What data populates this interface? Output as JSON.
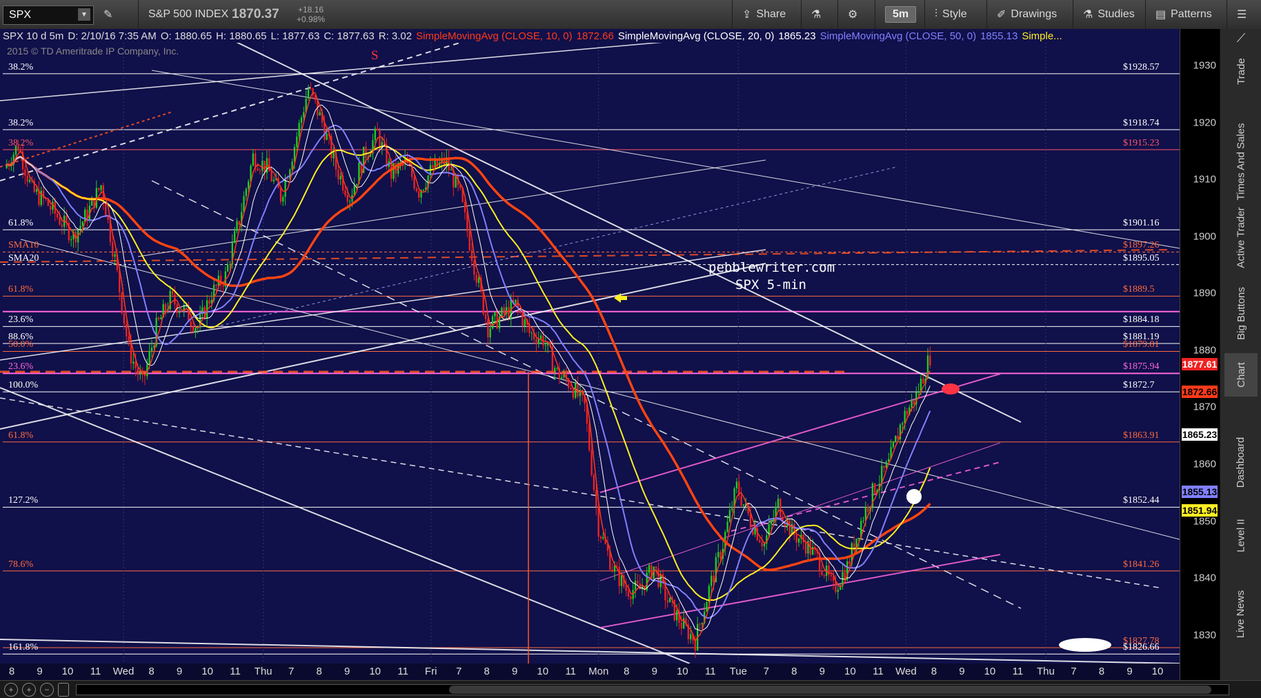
{
  "toolbar": {
    "symbol": "SPX",
    "index_name": "S&P 500 INDEX",
    "last_price": "1870.37",
    "change": "+18.16",
    "change_pct": "+0.98%",
    "share": "Share",
    "timeframe": "5m",
    "style": "Style",
    "drawings": "Drawings",
    "studies": "Studies",
    "patterns": "Patterns"
  },
  "studyline": {
    "desc": "SPX 10 d 5m",
    "date": "D: 2/10/16 7:35 AM",
    "open": "O: 1880.65",
    "high": "H: 1880.65",
    "low": "L: 1877.63",
    "close": "C: 1877.63",
    "range": "R: 3.02",
    "sma10_label": "SimpleMovingAvg (CLOSE, 10, 0)",
    "sma10_val": "1872.66",
    "sma20_label": "SimpleMovingAvg (CLOSE, 20, 0)",
    "sma20_val": "1865.23",
    "sma50_label": "SimpleMovingAvg (CLOSE, 50, 0)",
    "sma50_val": "1855.13",
    "more": "Simple..."
  },
  "copyright": "2015 © TD Ameritrade IP Company, Inc.",
  "watermark": {
    "line1": "pebblewriter.com",
    "line2": "SPX 5-min"
  },
  "marker_s": "S",
  "colors": {
    "sma10": "#ff3a1a",
    "sma20": "#ffffff",
    "sma50": "#8080ff",
    "sma200": "#ffee22",
    "fib": "#ff6b3d",
    "pink": "#ff66dd",
    "up": "#22cc22",
    "down": "#ee2222"
  },
  "chart_data": {
    "type": "candlestick",
    "title": "SPX 5-min",
    "ylim": [
      1825,
      1934
    ],
    "x_labels": [
      "8",
      "9",
      "10",
      "11",
      "Wed",
      "8",
      "9",
      "10",
      "11",
      "Thu",
      "7",
      "8",
      "9",
      "10",
      "11",
      "Fri",
      "7",
      "8",
      "9",
      "10",
      "11",
      "Mon",
      "8",
      "9",
      "10",
      "11",
      "Tue",
      "7",
      "8",
      "9",
      "10",
      "11",
      "Wed",
      "8",
      "9",
      "10",
      "11",
      "Thu",
      "7",
      "8",
      "9",
      "10"
    ],
    "y_ticks": [
      1830,
      1840,
      1850,
      1860,
      1870,
      1880,
      1890,
      1900,
      1910,
      1920,
      1930
    ],
    "price_tags": [
      {
        "value": 1877.61,
        "label": "1877.61",
        "bg": "#ee2222",
        "fg": "#ffffff"
      },
      {
        "value": 1872.66,
        "label": "1872.66",
        "bg": "#ff3a1a",
        "fg": "#000000"
      },
      {
        "value": 1865.23,
        "label": "1865.23",
        "bg": "#ffffff",
        "fg": "#000000"
      },
      {
        "value": 1855.13,
        "label": "1855.13",
        "bg": "#8080ff",
        "fg": "#000000"
      },
      {
        "value": 1851.94,
        "label": "1851.94",
        "bg": "#ffee22",
        "fg": "#000000"
      }
    ],
    "levels": [
      {
        "value": 1928.57,
        "label": "$1928.57",
        "color": "#ffffff",
        "left": "38.2%",
        "lc": "#ffffff"
      },
      {
        "value": 1918.74,
        "label": "$1918.74",
        "color": "#ffffff",
        "left": "38.2%",
        "lc": "#ffffff"
      },
      {
        "value": 1915.23,
        "label": "$1915.23",
        "color": "#ff5566",
        "left": "38.2%",
        "lc": "#ff5566"
      },
      {
        "value": 1901.16,
        "label": "$1901.16",
        "color": "#ffffff",
        "left": "61.8%",
        "lc": "#ffffff"
      },
      {
        "value": 1897.26,
        "label": "$1897.26",
        "color": "#ff6b3d",
        "left": "SMA10",
        "lc": "#ff6b3d"
      },
      {
        "value": 1895.05,
        "label": "$1895.05",
        "color": "#ffffff",
        "left": "SMA20",
        "lc": "#ffffff"
      },
      {
        "value": 1889.5,
        "label": "$1889.5",
        "color": "#ff6b3d",
        "left": "61.8%",
        "lc": "#ff6b3d"
      },
      {
        "value": 1886.8,
        "label": "",
        "color": "#ff66dd",
        "left": "",
        "lc": "#ff66dd"
      },
      {
        "value": 1884.18,
        "label": "$1884.18",
        "color": "#ffffff",
        "left": "23.6%",
        "lc": "#ffffff"
      },
      {
        "value": 1881.19,
        "label": "$1881.19",
        "color": "#ffffff",
        "left": "88.6%",
        "lc": "#ffffff"
      },
      {
        "value": 1879.81,
        "label": "$1879.81",
        "color": "#ff6b3d",
        "left": "50.0%",
        "lc": "#ff6b3d"
      },
      {
        "value": 1875.94,
        "label": "$1875.94",
        "color": "#ff66dd",
        "left": "23.6%",
        "lc": "#ff66dd"
      },
      {
        "value": 1872.7,
        "label": "$1872.7",
        "color": "#ffffff",
        "left": "100.0%",
        "lc": "#ffffff"
      },
      {
        "value": 1863.91,
        "label": "$1863.91",
        "color": "#ff6b3d",
        "left": "61.8%",
        "lc": "#ff6b3d"
      },
      {
        "value": 1852.44,
        "label": "$1852.44",
        "color": "#ffffff",
        "left": "127.2%",
        "lc": "#ffffff"
      },
      {
        "value": 1841.26,
        "label": "$1841.26",
        "color": "#ff6b3d",
        "left": "78.6%",
        "lc": "#ff6b3d"
      },
      {
        "value": 1827.78,
        "label": "$1827.78",
        "color": "#ff6b3d",
        "left": "",
        "lc": "#ff6b3d"
      },
      {
        "value": 1826.66,
        "label": "$1826.66",
        "color": "#ffffff",
        "left": "161.8%",
        "lc": "#ffffff"
      }
    ],
    "price_path": [
      1912,
      1916,
      1908,
      1906,
      1903,
      1900,
      1904,
      1909,
      1896,
      1880,
      1874,
      1884,
      1889,
      1887,
      1884,
      1890,
      1893,
      1903,
      1914,
      1912,
      1907,
      1916,
      1926,
      1920,
      1912,
      1907,
      1914,
      1918,
      1911,
      1913,
      1908,
      1912,
      1913,
      1907,
      1895,
      1884,
      1886,
      1888,
      1883,
      1882,
      1876,
      1874,
      1870,
      1849,
      1842,
      1838,
      1838,
      1842,
      1836,
      1832,
      1829,
      1838,
      1846,
      1856,
      1850,
      1846,
      1853,
      1848,
      1846,
      1843,
      1838,
      1842,
      1850,
      1856,
      1860,
      1868,
      1872,
      1879
    ]
  },
  "sidebar": {
    "tabs": [
      "Trade",
      "Times And Sales",
      "Active Trader",
      "Big Buttons",
      "Chart",
      "Dashboard",
      "Level II",
      "Live News"
    ]
  }
}
